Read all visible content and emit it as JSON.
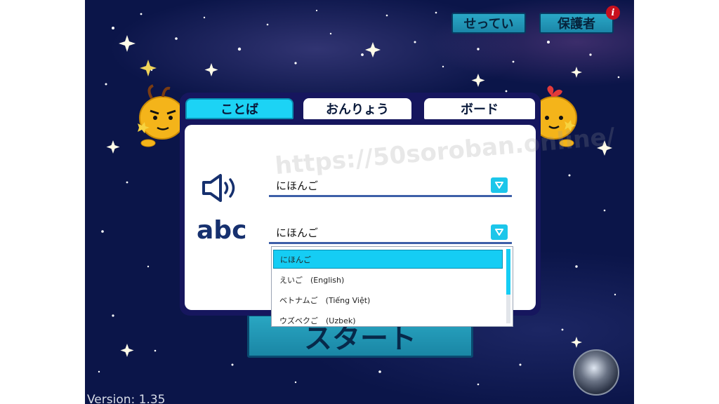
{
  "header": {
    "settings_label": "せってい",
    "guardian_label": "保護者",
    "info_badge": "i"
  },
  "tabs": [
    {
      "label": "ことば",
      "active": true
    },
    {
      "label": "おんりょう",
      "active": false
    },
    {
      "label": "ボード",
      "active": false
    }
  ],
  "watermark": "https://50soroban.online/",
  "language": {
    "voice_value": "にほんご",
    "text_label": "abc",
    "text_value": "にほんご"
  },
  "dropdown": {
    "options": [
      {
        "label": "にほんご",
        "selected": true
      },
      {
        "label": "えいご　(English)",
        "selected": false
      },
      {
        "label": "ベトナムご　(Tiếng Việt)",
        "selected": false
      },
      {
        "label": "ウズベクご　(Uzbek)",
        "selected": false
      }
    ]
  },
  "start_label": "スタート",
  "version": "Version: 1.35",
  "colors": {
    "accent": "#1cd3f5",
    "background": "#0b1549",
    "button": "#2aa7c6"
  },
  "icons": [
    "speaker-icon",
    "dropdown-arrow-icon",
    "info-icon",
    "siri-icon"
  ]
}
